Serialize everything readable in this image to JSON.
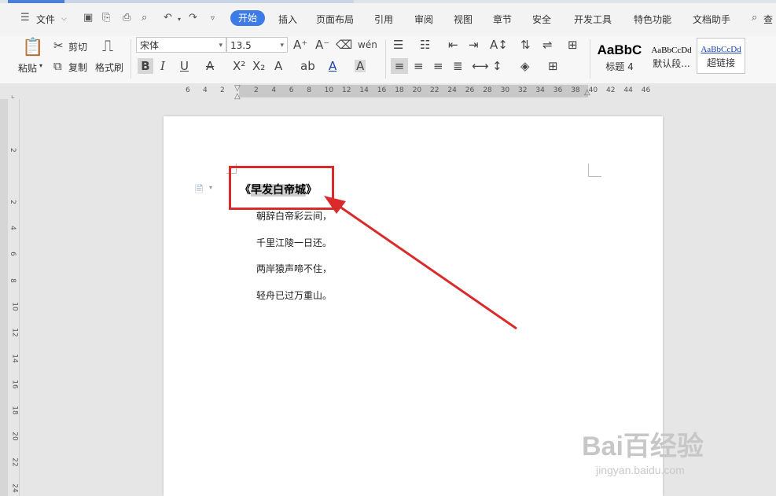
{
  "menu": {
    "file": "文件",
    "tabs": [
      "开始",
      "插入",
      "页面布局",
      "引用",
      "审阅",
      "视图",
      "章节",
      "安全",
      "开发工具",
      "特色功能",
      "文档助手"
    ],
    "search": "查"
  },
  "clipboard": {
    "paste": "粘贴",
    "cut": "剪切",
    "copy": "复制",
    "format_painter": "格式刷"
  },
  "font": {
    "name": "宋体",
    "size": "13.5"
  },
  "styles": [
    {
      "preview": "AaBbC",
      "label": "标题 4"
    },
    {
      "preview": "AaBbCcDd",
      "label": "默认段..."
    },
    {
      "preview": "AaBbCcDd",
      "label": "超链接"
    }
  ],
  "ruler": {
    "h_left": [
      "6",
      "4",
      "2"
    ],
    "h_right": [
      "2",
      "4",
      "6",
      "8",
      "10",
      "12",
      "14",
      "16",
      "18",
      "20",
      "22",
      "24",
      "26",
      "28",
      "30",
      "32",
      "34",
      "36",
      "38",
      "40",
      "42",
      "44",
      "46"
    ],
    "v": [
      "2",
      "2",
      "4",
      "6",
      "8",
      "10",
      "12",
      "14",
      "16",
      "18",
      "20",
      "22",
      "24"
    ]
  },
  "document": {
    "title_open": "《",
    "title_hl": "早发白帝城",
    "title_close": "》",
    "lines": [
      "朝辞白帝彩云间，",
      "千里江陵一日还。",
      "两岸猿声啼不住，",
      "轻舟已过万重山。"
    ]
  },
  "watermark": {
    "main": "Bai百经验",
    "sub": "jingyan.baidu.com"
  },
  "colors": {
    "accent": "#3d7ce6",
    "annotation": "#d92b2b"
  }
}
